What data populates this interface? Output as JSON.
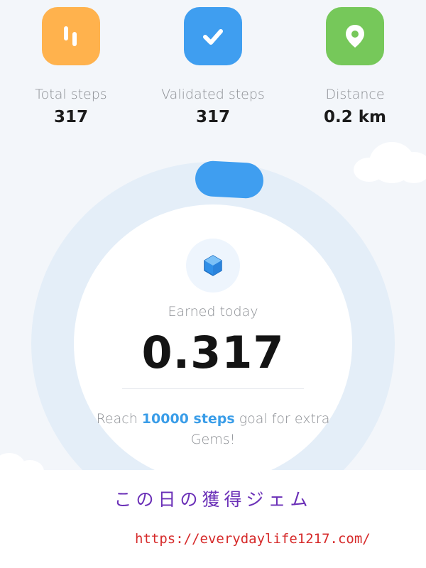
{
  "stats": [
    {
      "label": "Total steps",
      "value": "317",
      "icon": "steps-icon",
      "color": "#ffb24d"
    },
    {
      "label": "Validated steps",
      "value": "317",
      "icon": "checkmark-icon",
      "color": "#3f9ef0"
    },
    {
      "label": "Distance",
      "value": "0.2 km",
      "icon": "location-pin-icon",
      "color": "#76c85a"
    }
  ],
  "earned": {
    "icon": "gem-icon",
    "label": "Earned today",
    "value": "0.317",
    "progress_color": "#3f9ef0"
  },
  "goal": {
    "prefix": "Reach ",
    "highlight": "10000 steps",
    "suffix": " goal for extra Gems!",
    "accent_color": "#3a9de8"
  },
  "overlay": {
    "caption": "この日の獲得ジェム",
    "url": "https://everydaylife1217.com/"
  }
}
